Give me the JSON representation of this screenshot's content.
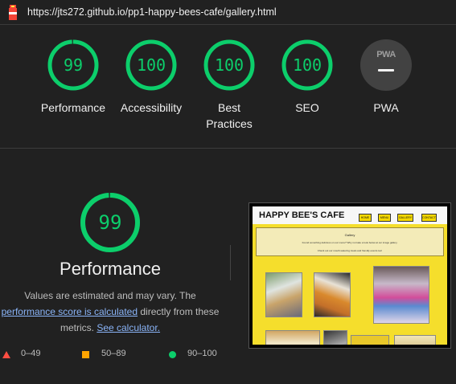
{
  "url": "https://jts272.github.io/pp1-happy-bees-cafe/gallery.html",
  "colors": {
    "pass": "#0cce6b",
    "average": "#ffa400",
    "fail": "#ff4e42",
    "background": "#212121"
  },
  "categories": [
    {
      "score": "99",
      "label": "Performance"
    },
    {
      "score": "100",
      "label": "Accessibility"
    },
    {
      "score": "100",
      "label": "Best Practices"
    },
    {
      "score": "100",
      "label": "SEO"
    }
  ],
  "pwa": {
    "badge": "PWA",
    "label": "PWA"
  },
  "performance": {
    "score": "99",
    "title": "Performance",
    "desc_prefix": "Values are estimated and may vary. The",
    "score_link": "performance score is calculated",
    "desc_middle": "directly from these metrics.",
    "calc_link": "See calculator."
  },
  "legend": [
    {
      "range": "0–49",
      "icon": "triangle-icon"
    },
    {
      "range": "50–89",
      "icon": "square-icon"
    },
    {
      "range": "90–100",
      "icon": "circle-icon"
    }
  ],
  "screenshot": {
    "site_title": "HAPPY BEE'S CAFE",
    "nav": [
      "HOME",
      "MENU",
      "GALLERY",
      "CONTACT"
    ],
    "heading": "Gallery",
    "text1": "Found something delicious on our menu? Why not take a look below at our image gallery.",
    "text2": "Check out our mouth-watering treats and friendly events too!"
  }
}
